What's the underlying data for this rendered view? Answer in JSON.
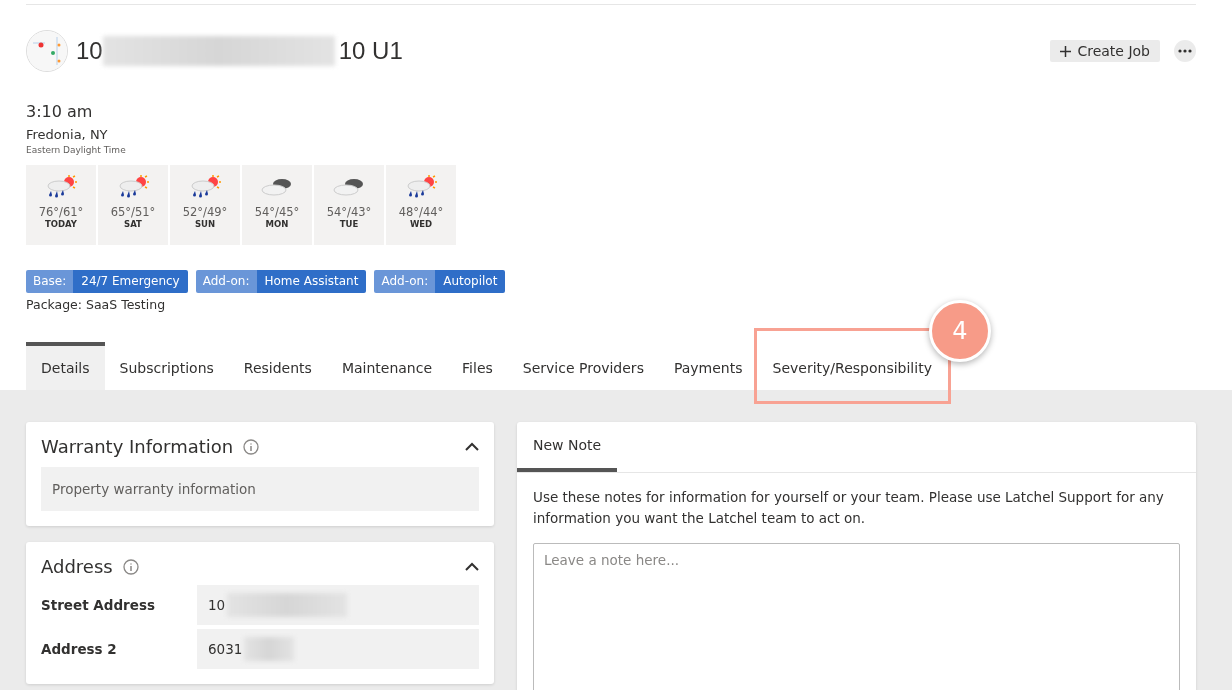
{
  "header": {
    "title_start": "10",
    "title_end": "10 U1",
    "create_button": "Create Job"
  },
  "local": {
    "time": "3:10 am",
    "city": "Fredonia, NY",
    "timezone": "Eastern Daylight Time"
  },
  "forecast": [
    {
      "kind": "rain_sun",
      "temps": "76°/61°",
      "day": "TODAY"
    },
    {
      "kind": "rain_sun",
      "temps": "65°/51°",
      "day": "SAT"
    },
    {
      "kind": "rain_sun",
      "temps": "52°/49°",
      "day": "SUN"
    },
    {
      "kind": "cloudy",
      "temps": "54°/45°",
      "day": "MON"
    },
    {
      "kind": "cloudy",
      "temps": "54°/43°",
      "day": "TUE"
    },
    {
      "kind": "rain_sun",
      "temps": "48°/44°",
      "day": "WED"
    }
  ],
  "plans": [
    {
      "type": "Base:",
      "name": "24/7 Emergency"
    },
    {
      "type": "Add-on:",
      "name": "Home Assistant"
    },
    {
      "type": "Add-on:",
      "name": "Autopilot"
    }
  ],
  "package": "Package: SaaS Testing",
  "tabs": [
    {
      "label": "Details",
      "selected": true
    },
    {
      "label": "Subscriptions",
      "selected": false
    },
    {
      "label": "Residents",
      "selected": false
    },
    {
      "label": "Maintenance",
      "selected": false
    },
    {
      "label": "Files",
      "selected": false
    },
    {
      "label": "Service Providers",
      "selected": false
    },
    {
      "label": "Payments",
      "selected": false
    },
    {
      "label": "Severity/Responsibility",
      "selected": false,
      "highlighted": true
    }
  ],
  "callout": "4",
  "warranty": {
    "title": "Warranty Information",
    "placeholder": "Property warranty information"
  },
  "address": {
    "title": "Address",
    "fields": [
      {
        "label": "Street Address",
        "value": "10"
      },
      {
        "label": "Address 2",
        "value": "6031"
      }
    ]
  },
  "note": {
    "tab": "New Note",
    "hint": "Use these notes for information for yourself or your team. Please use Latchel Support for any information you want the Latchel team to act on.",
    "placeholder": "Leave a note here..."
  }
}
